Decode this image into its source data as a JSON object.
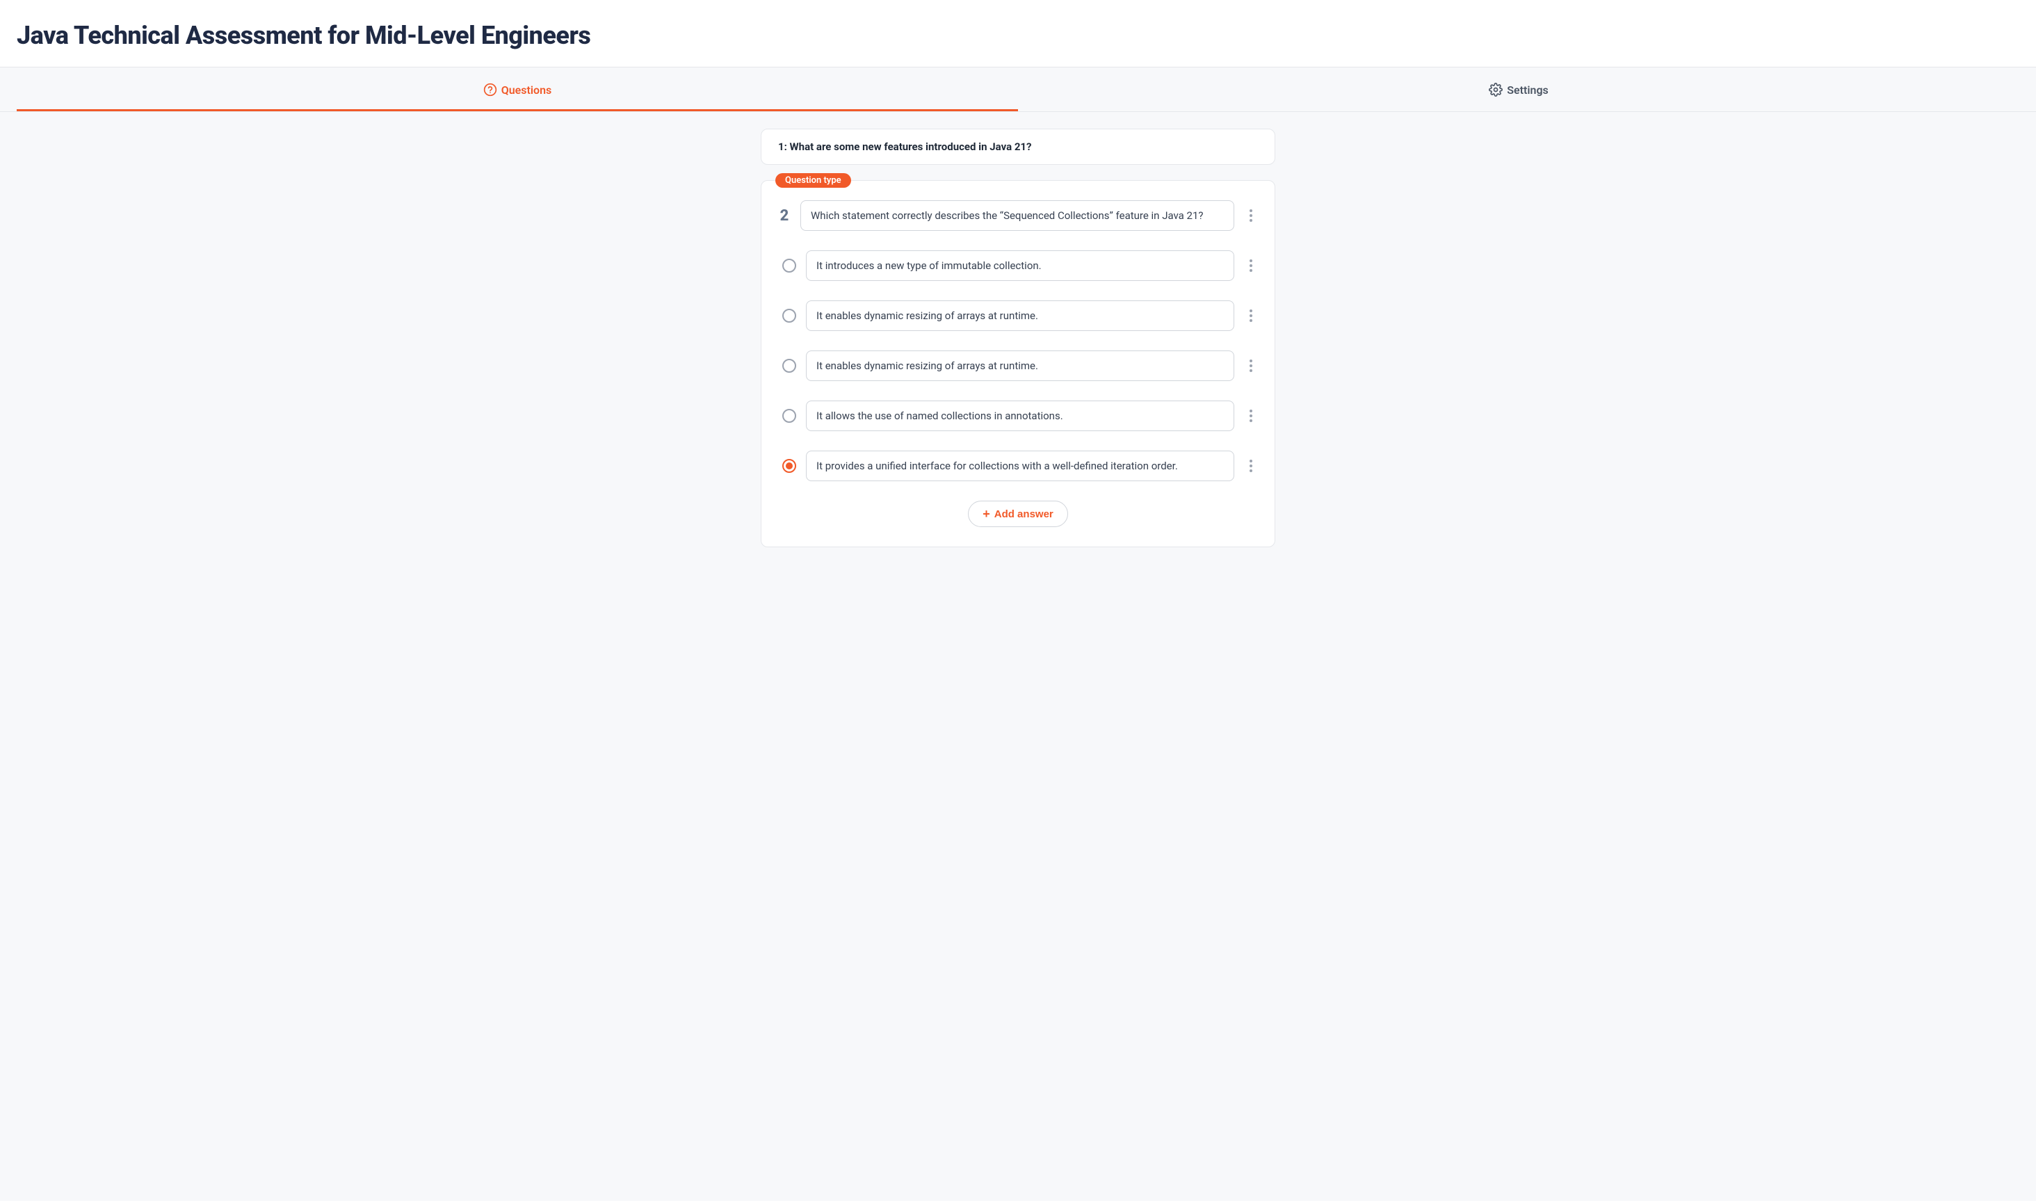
{
  "page_title": "Java Technical Assessment for Mid-Level Engineers",
  "tabs": {
    "questions": "Questions",
    "settings": "Settings"
  },
  "question1": {
    "label": "1: What are some new features introduced in Java 21?"
  },
  "question2": {
    "badge": "Question type",
    "number": "2",
    "text": "Which statement correctly describes the “Sequenced Collections” feature in Java 21?",
    "answers": [
      {
        "text": "It introduces a new type of immutable collection.",
        "selected": false
      },
      {
        "text": "It enables dynamic resizing of arrays at runtime.",
        "selected": false
      },
      {
        "text": "It enables dynamic resizing of arrays at runtime.",
        "selected": false
      },
      {
        "text": "It allows the use of named collections in annotations.",
        "selected": false
      },
      {
        "text": "It provides a unified interface for collections with a well-defined iteration order.",
        "selected": true
      }
    ],
    "add_answer_label": "Add answer"
  }
}
